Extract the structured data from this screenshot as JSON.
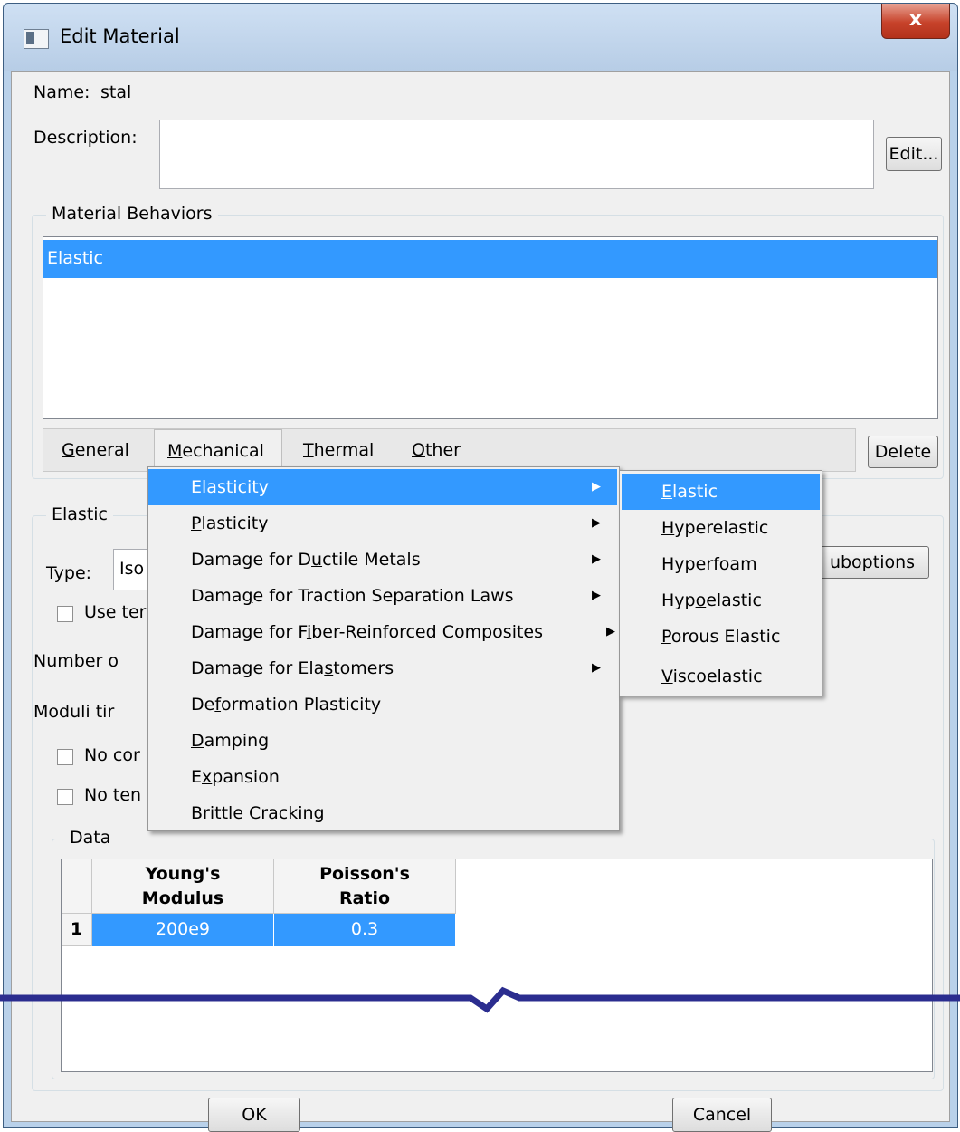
{
  "window": {
    "title": "Edit Material",
    "close_label": "x"
  },
  "name": {
    "label": "Name:",
    "value": "stal"
  },
  "description": {
    "label": "Description:",
    "value": "",
    "edit_button": "Edit..."
  },
  "behaviors": {
    "group_title": "Material Behaviors",
    "items": [
      "Elastic"
    ],
    "tabs": [
      "General",
      "Mechanical",
      "Thermal",
      "Other"
    ],
    "delete_button": "Delete"
  },
  "mechanical_menu": {
    "items": [
      {
        "label": "Elasticity",
        "has_submenu": true,
        "highlighted": true
      },
      {
        "label": "Plasticity",
        "has_submenu": true
      },
      {
        "label": "Damage for Ductile Metals",
        "has_submenu": true
      },
      {
        "label": "Damage for Traction Separation Laws",
        "has_submenu": true
      },
      {
        "label": "Damage for Fiber-Reinforced Composites",
        "has_submenu": true
      },
      {
        "label": "Damage for Elastomers",
        "has_submenu": true
      },
      {
        "label": "Deformation Plasticity",
        "has_submenu": false
      },
      {
        "label": "Damping",
        "has_submenu": false
      },
      {
        "label": "Expansion",
        "has_submenu": false
      },
      {
        "label": "Brittle Cracking",
        "has_submenu": false
      }
    ]
  },
  "elasticity_submenu": {
    "items": [
      {
        "label": "Elastic",
        "highlighted": true
      },
      {
        "label": "Hyperelastic"
      },
      {
        "label": "Hyperfoam"
      },
      {
        "label": "Hypoelastic"
      },
      {
        "label": "Porous Elastic"
      },
      {
        "label": "Viscoelastic"
      }
    ]
  },
  "elastic": {
    "group_title": "Elastic",
    "type_label": "Type:",
    "type_value": "Iso",
    "suboptions_button": "uboptions",
    "use_temp_label": "Use ter",
    "number_label": "Number o",
    "moduli_label": "Moduli tir",
    "no_compression_label": "No cor",
    "no_tension_label": "No ten"
  },
  "data": {
    "group_title": "Data",
    "columns": [
      "Young's\nModulus",
      "Poisson's\nRatio"
    ],
    "rows": [
      {
        "index": "1",
        "values": [
          "200e9",
          "0.3"
        ]
      }
    ]
  },
  "footer": {
    "ok_button": "OK",
    "cancel_button": "Cancel"
  },
  "colors": {
    "selection": "#3399ff",
    "break_line": "#2b2d8f"
  }
}
